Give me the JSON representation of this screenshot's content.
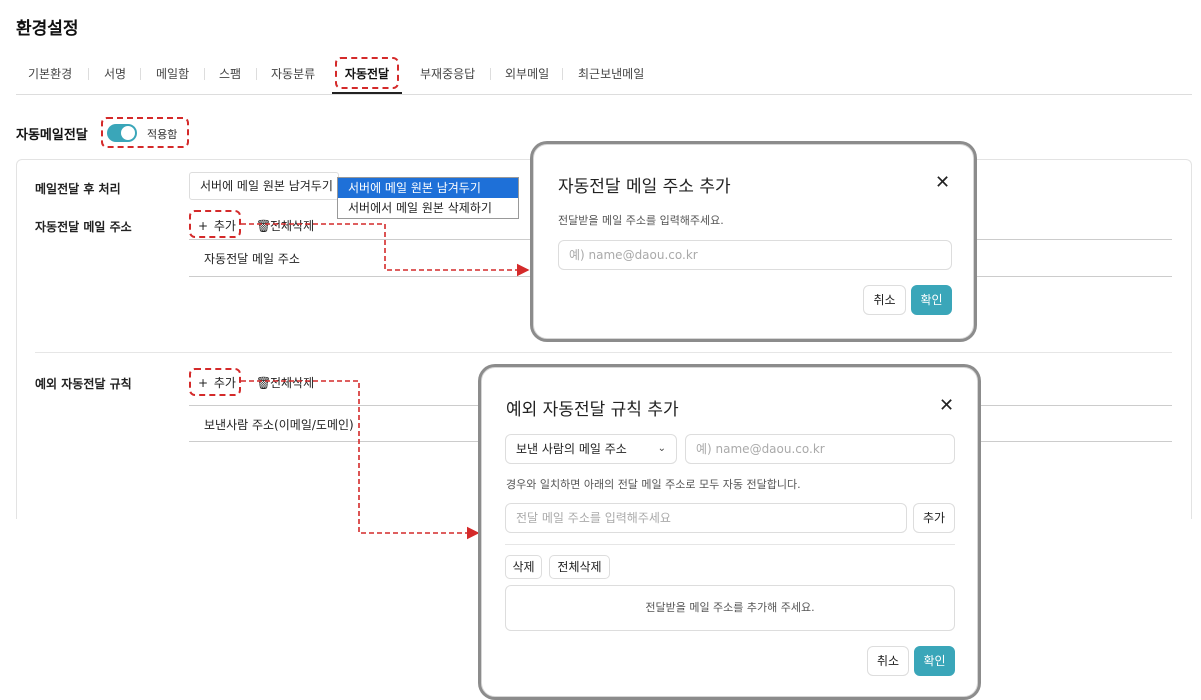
{
  "page": {
    "title": "환경설정"
  },
  "tabs": [
    {
      "label": "기본환경"
    },
    {
      "label": "서명"
    },
    {
      "label": "메일함"
    },
    {
      "label": "스팸"
    },
    {
      "label": "자동분류"
    },
    {
      "label": "자동전달",
      "active": true
    },
    {
      "label": "부재중응답"
    },
    {
      "label": "외부메일"
    },
    {
      "label": "최근보낸메일"
    }
  ],
  "auto_forward": {
    "title": "자동메일전달",
    "toggle_on": true,
    "toggle_label": "적용함"
  },
  "after_process": {
    "label": "메일전달 후 처리",
    "selected": "서버에 메일 원본 남겨두기",
    "options": [
      "서버에 메일 원본 남겨두기",
      "서버에서 메일 원본 삭제하기"
    ]
  },
  "forward_address": {
    "label": "자동전달 메일 주소",
    "add_label": "추가",
    "delete_all_label": "전체삭제",
    "column_header": "자동전달 메일 주소"
  },
  "exception_rule": {
    "label": "예외 자동전달 규칙",
    "add_label": "추가",
    "delete_all_label": "전체삭제",
    "column_header": "보낸사람 주소(이메일/도메인)"
  },
  "modal_address": {
    "title": "자동전달 메일 주소 추가",
    "description": "전달받을 메일 주소를 입력해주세요.",
    "placeholder": "예) name@daou.co.kr",
    "cancel_label": "취소",
    "confirm_label": "확인"
  },
  "modal_rule": {
    "title": "예외 자동전달 규칙 추가",
    "condition_select": "보낸 사람의 메일 주소",
    "condition_placeholder": "예) name@daou.co.kr",
    "description": "경우와 일치하면 아래의 전달 메일 주소로 모두 자동 전달합니다.",
    "forward_placeholder": "전달 메일 주소를 입력해주세요",
    "add_label": "추가",
    "delete_label": "삭제",
    "delete_all_label": "전체삭제",
    "empty_message": "전달받을 메일 주소를 추가해 주세요.",
    "cancel_label": "취소",
    "confirm_label": "확인"
  },
  "colors": {
    "accent": "#3aa6b9",
    "annotation": "#d42a2a",
    "select_highlight": "#1e70d8"
  },
  "icons": {
    "add": "plus-icon",
    "delete": "trash-icon",
    "close": "close-icon",
    "dropdown": "chevron-down-icon"
  }
}
